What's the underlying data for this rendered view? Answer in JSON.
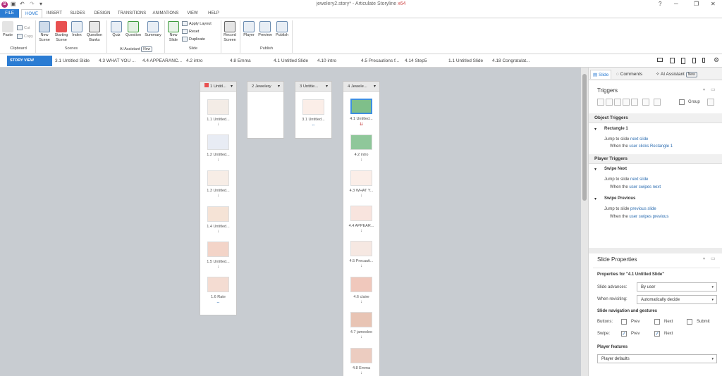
{
  "window": {
    "title": "jewelery2.story*",
    "app": "Articulate Storyline",
    "x64": "x64",
    "logo": "S"
  },
  "quick_access": {
    "undo": "↶",
    "redo": "↷",
    "more": "▾"
  },
  "window_controls": {
    "help": "?",
    "minimize": "─",
    "restore": "❐",
    "close": "✕"
  },
  "tabs": [
    "FILE",
    "HOME",
    "INSERT",
    "SLIDES",
    "DESIGN",
    "TRANSITIONS",
    "ANIMATIONS",
    "VIEW",
    "HELP"
  ],
  "ribbon": {
    "paste": "Paste",
    "cut": "Cut",
    "copy": "Copy",
    "clipboard": "Clipboard",
    "new_scene": "New Scene",
    "starting_scene": "Starting Scene",
    "index": "Index",
    "question_banks": "Question Banks",
    "scenes": "Scenes",
    "quiz": "Quiz",
    "question": "Question",
    "summary": "Summary",
    "ai_assistant": "AI Assistant",
    "new_badge": "New",
    "new_slide": "New Slide",
    "apply_layout": "Apply Layout",
    "reset": "Reset",
    "duplicate": "Duplicate",
    "slide": "Slide",
    "record_screen": "Record Screen",
    "player": "Player",
    "preview": "Preview",
    "publish": "Publish",
    "publish_group": "Publish"
  },
  "story_view": "STORY VIEW",
  "open_tabs": [
    "3.1 Untitled Slide",
    "4.3 WHAT YOU ...",
    "4.4 APPEARANC...",
    "4.2 intro",
    "4.8 Emma",
    "4.1 Untitled Slide",
    "4.10 intro",
    "4.5 Precautions f...",
    "4.14 Step5",
    "1.1 Untitled Slide",
    "4.18 Congratulat..."
  ],
  "scenes": [
    {
      "name": "1 Untitl...",
      "slides": [
        "1.1 Untitled...",
        "1.2 Untitled...",
        "1.3 Untitled...",
        "1.4 Untitled...",
        "1.5 Untitled...",
        "1.6 Rate"
      ]
    },
    {
      "name": "2 Jewelery",
      "slides": []
    },
    {
      "name": "3 Untitle...",
      "slides": [
        "3.1 Untitled..."
      ]
    },
    {
      "name": "4 Jewele...",
      "slides": [
        "4.1 Untitled...",
        "4.2 intro",
        "4.3 WHAT Y...",
        "4.4 APPEAR...",
        "4.5 Precauti...",
        "4.6 claire",
        "4.7 jamesleo",
        "4.8 Emma"
      ]
    }
  ],
  "glyphs": {
    "arrow": "↓",
    "link": "⇔",
    "dropdown": "▾",
    "double_arrow": "⇊"
  },
  "panel": {
    "tabs": {
      "slide": "Slide",
      "comments": "Comments",
      "ai": "AI Assistant",
      "new": "New"
    },
    "triggers_title": "Triggers",
    "group": "Group",
    "object_triggers": "Object Triggers",
    "rect": "Rectangle 1",
    "jump_to_slide": "Jump to slide",
    "next_slide": "next slide",
    "previous_slide": "previous slide",
    "when_the": "When the",
    "user_clicks": "user clicks",
    "user_swipes": "user swipes",
    "next": "next",
    "previous": "previous",
    "player_triggers": "Player Triggers",
    "swipe_next": "Swipe Next",
    "swipe_previous": "Swipe Previous",
    "slide_properties": "Slide Properties",
    "properties_for": "Properties for \"4.1 Untitled Slide\"",
    "slide_advances": "Slide advances:",
    "slide_advances_value": "By user",
    "when_revisiting": "When revisiting:",
    "when_revisiting_value": "Automatically decide",
    "nav_gestures": "Slide navigation and gestures",
    "buttons": "Buttons:",
    "prev": "Prev",
    "next_label": "Next",
    "submit": "Submit",
    "swipe": "Swipe:",
    "player_features": "Player features",
    "player_defaults": "Player defaults",
    "check": "✓"
  }
}
